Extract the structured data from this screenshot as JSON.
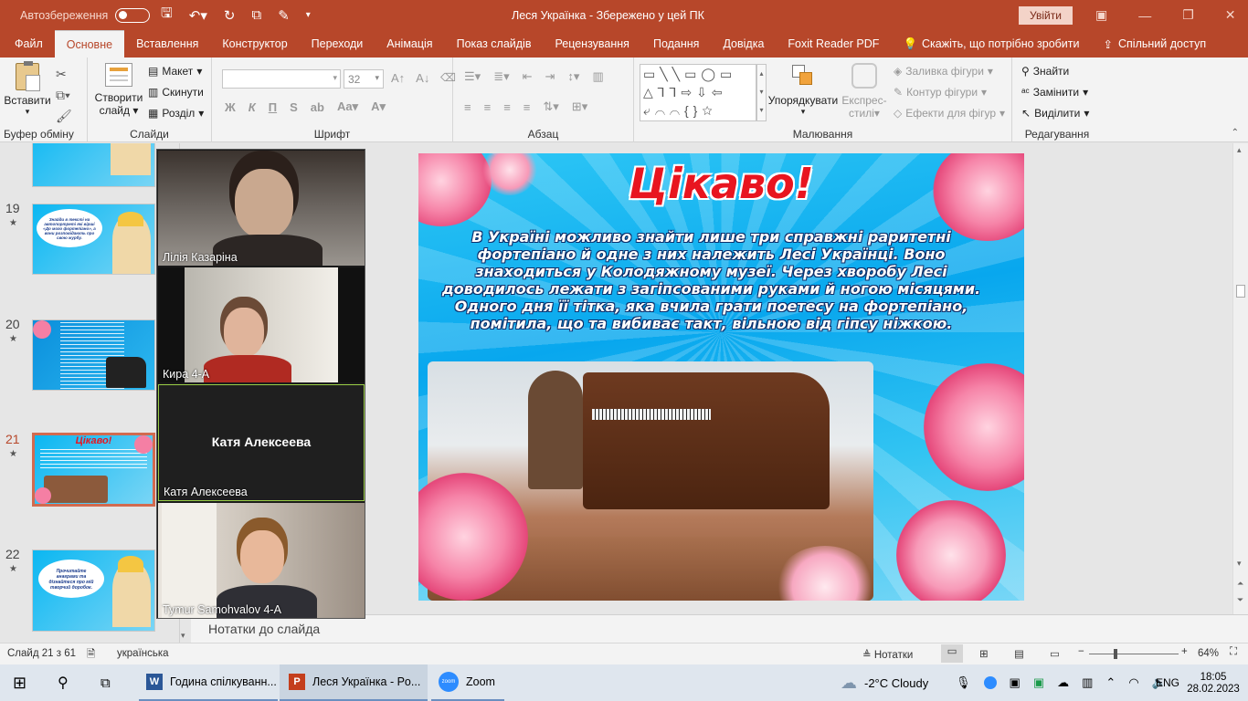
{
  "titlebar": {
    "autosave_label": "Автозбереження",
    "autosave_state": "Вимк",
    "title": "Леся Українка  -  Збережено у цей ПК",
    "signin": "Увійти"
  },
  "tabs": [
    "Файл",
    "Основне",
    "Вставлення",
    "Конструктор",
    "Переходи",
    "Анімація",
    "Показ слайдів",
    "Рецензування",
    "Подання",
    "Довідка",
    "Foxit Reader PDF",
    "Скажіть, що потрібно зробити"
  ],
  "share": "Спільний доступ",
  "ribbon": {
    "clipboard": {
      "paste": "Вставити",
      "label": "Буфер обміну"
    },
    "slides": {
      "new_slide": "Створити",
      "new_slide2": "слайд",
      "layout": "Макет",
      "reset": "Скинути",
      "section": "Розділ",
      "label": "Слайди"
    },
    "font": {
      "size": "32",
      "bold": "Ж",
      "italic": "К",
      "underline": "П",
      "strike": "S",
      "label": "Шрифт"
    },
    "paragraph": {
      "label": "Абзац"
    },
    "drawing": {
      "arrange": "Упорядкувати",
      "quick_styles": "Експрес-",
      "quick_styles2": "стилі",
      "fill": "Заливка фігури",
      "outline": "Контур фігури",
      "effects": "Ефекти для фігур",
      "label": "Малювання"
    },
    "editing": {
      "find": "Знайти",
      "replace": "Замінити",
      "select": "Виділити",
      "label": "Редагування"
    }
  },
  "thumbnails": [
    {
      "num": "19",
      "star": "★"
    },
    {
      "num": "20",
      "star": "★"
    },
    {
      "num": "21",
      "star": "★"
    },
    {
      "num": "22",
      "star": "★"
    }
  ],
  "thumb_texts": {
    "t19": "Знайди в тексті на автопортреті які вірші «До мого фортепіано», а вони розповідають про свою журбу.",
    "t21_title": "Цікаво!",
    "t22": "Прочитайте анаграми та дізнайтеся про мій творчий доробок."
  },
  "slide": {
    "title": "Цікаво!",
    "text": "В Україні можливо знайти лише три справжні раритетні фортепіано й одне з них належить Лесі Українці. Воно знаходиться у Колодяжному музеї. Через хворобу Лесі доводилось лежати з загіпсованими руками й ногою місяцями. Одного дня її тітка, яка вчила грати поетесу на фортепіано, помітила, що та вибиває такт, вільною від гіпсу ніжкою."
  },
  "notes_placeholder": "Нотатки до слайда",
  "status": {
    "slide_info": "Слайд 21 з 61",
    "language": "українська",
    "notes": "Нотатки",
    "zoom": "64%"
  },
  "zoom_participants": [
    {
      "name": "Лілія Казаріна"
    },
    {
      "name": "Кира 4-А"
    },
    {
      "name": "Катя Алексеева",
      "center": "Катя Алексеева"
    },
    {
      "name": "Tymur Samohvalov 4-A"
    }
  ],
  "taskbar": {
    "apps": [
      "Година спілкуванн...",
      "Леся Українка - Po...",
      "Zoom"
    ],
    "weather": "-2°C  Cloudy",
    "lang": "ENG",
    "time": "18:05",
    "date": "28.02.2023"
  },
  "colors": {
    "ppt_accent": "#b7472a",
    "slide_title": "#e8151f",
    "selected_thumb": "#d26a4f"
  }
}
